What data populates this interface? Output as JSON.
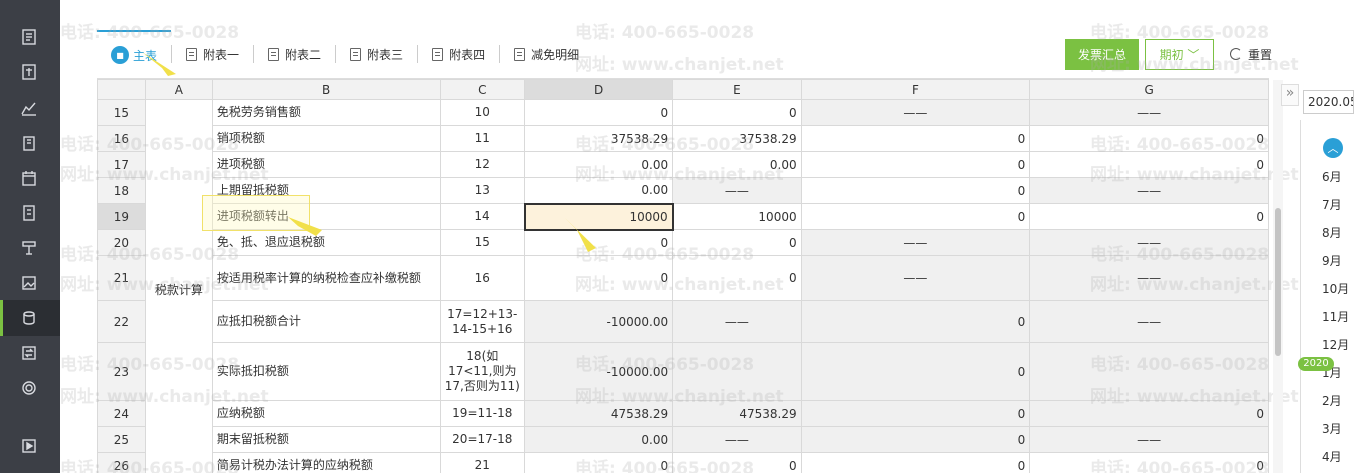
{
  "tabs": [
    {
      "label": "主表",
      "active": true
    },
    {
      "label": "附表一"
    },
    {
      "label": "附表二"
    },
    {
      "label": "附表三"
    },
    {
      "label": "附表四"
    },
    {
      "label": "减免明细"
    }
  ],
  "buttons": {
    "invoice_summary": "发票汇总",
    "period": "期初",
    "reset": "重置"
  },
  "columns": [
    "A",
    "B",
    "C",
    "D",
    "E",
    "F",
    "G"
  ],
  "section_label": "税款计算",
  "rows": [
    {
      "n": "15",
      "b": "免税劳务销售额",
      "c": "10",
      "d": "0",
      "e": "0",
      "f": "——",
      "g": "——"
    },
    {
      "n": "16",
      "b": "销项税额",
      "c": "11",
      "d": "37538.29",
      "e": "37538.29",
      "f": "0",
      "g": "0"
    },
    {
      "n": "17",
      "b": "进项税额",
      "c": "12",
      "d": "0.00",
      "e": "0.00",
      "f": "0",
      "g": "0"
    },
    {
      "n": "18",
      "b": "上期留抵税额",
      "c": "13",
      "d": "0.00",
      "e": "——",
      "f": "0",
      "g": "——"
    },
    {
      "n": "19",
      "b": "进项税额转出",
      "c": "14",
      "d": "10000",
      "e": "10000",
      "f": "0",
      "g": "0"
    },
    {
      "n": "20",
      "b": "免、抵、退应退税额",
      "c": "15",
      "d": "0",
      "e": "0",
      "f": "——",
      "g": "——"
    },
    {
      "n": "21",
      "b": "按适用税率计算的纳税检查应补缴税额",
      "c": "16",
      "d": "0",
      "e": "0",
      "f": "——",
      "g": "——"
    },
    {
      "n": "22",
      "b": "应抵扣税额合计",
      "c": "17=12+13-14-15+16",
      "d": "-10000.00",
      "e": "——",
      "f": "0",
      "g": "——"
    },
    {
      "n": "23",
      "b": "实际抵扣税额",
      "c": "18(如17<11,则为17,否则为11)",
      "d": "-10000.00",
      "e": "",
      "f": "0",
      "g": ""
    },
    {
      "n": "24",
      "b": "应纳税额",
      "c": "19=11-18",
      "d": "47538.29",
      "e": "47538.29",
      "f": "0",
      "g": "0"
    },
    {
      "n": "25",
      "b": "期末留抵税额",
      "c": "20=17-18",
      "d": "0.00",
      "e": "——",
      "f": "0",
      "g": "——"
    },
    {
      "n": "26",
      "b": "简易计税办法计算的应纳税额",
      "c": "21",
      "d": "0",
      "e": "0",
      "f": "0",
      "g": "0"
    }
  ],
  "side": {
    "date_value": "2020.05",
    "months_top": [
      "6月",
      "7月",
      "8月",
      "9月",
      "10月",
      "11月",
      "12月"
    ],
    "year": "2020",
    "months_bottom": [
      "1月",
      "2月",
      "3月",
      "4月"
    ]
  },
  "watermark": {
    "phone": "电话: 400-665-0028",
    "site": "网址: www.chanjet.net"
  },
  "colors": {
    "accent_green": "#7bc142",
    "accent_blue": "#2a9fd6",
    "nav_bg": "#3c3f46",
    "selected_cell": "#fdf2dc"
  }
}
